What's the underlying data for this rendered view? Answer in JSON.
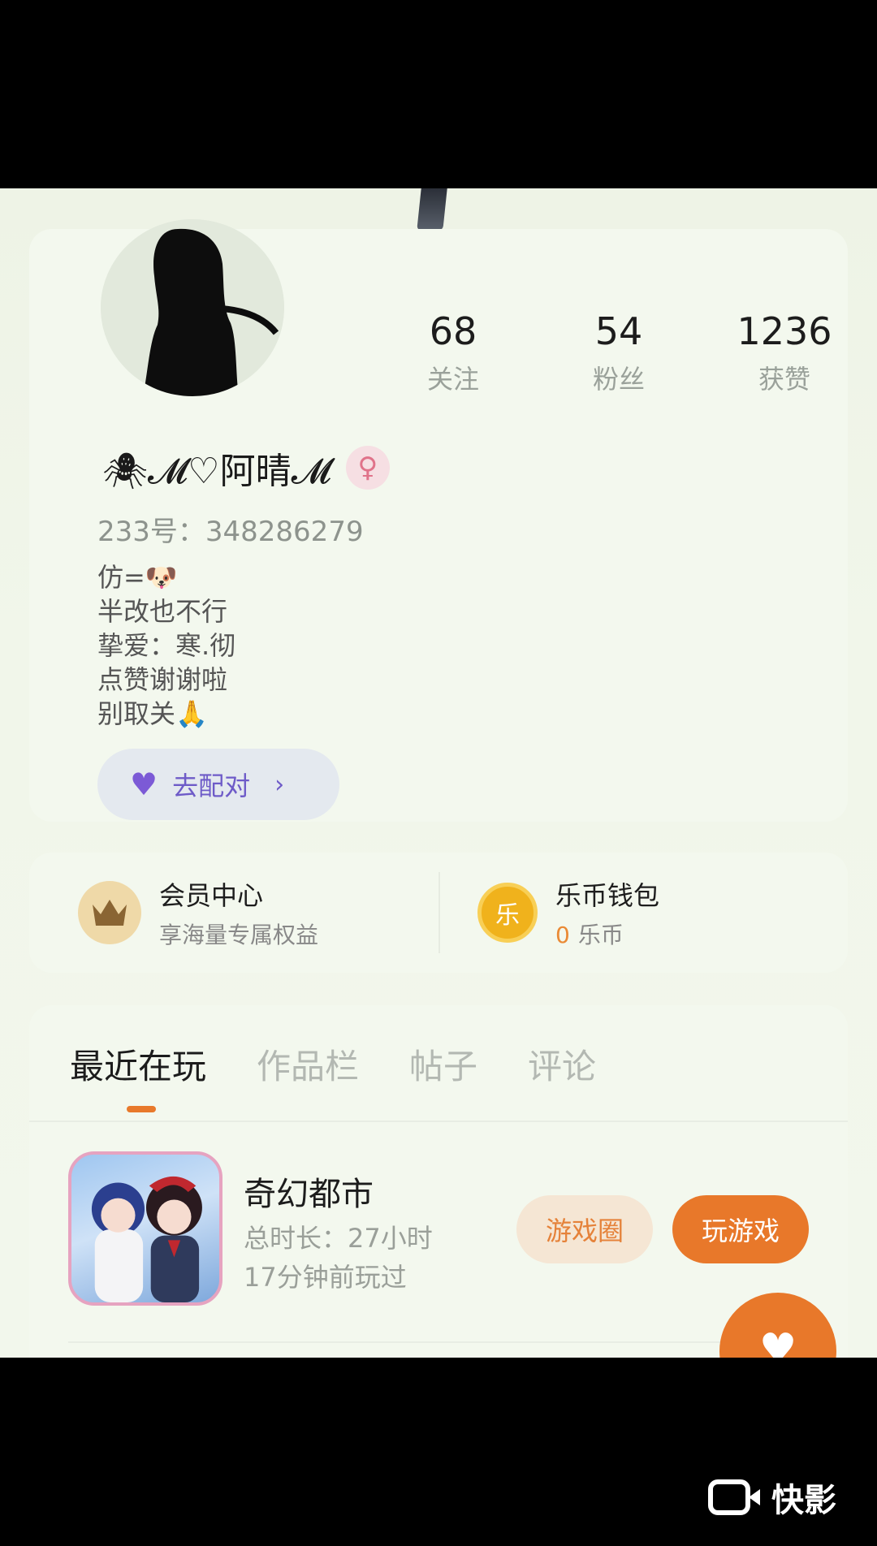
{
  "profile": {
    "stats": [
      {
        "value": "68",
        "label": "关注"
      },
      {
        "value": "54",
        "label": "粉丝"
      },
      {
        "value": "1236",
        "label": "获赞"
      }
    ],
    "name": "🕷𝓜♡阿晴𝓜",
    "gender_icon": "♀",
    "uid_text": "233号：348286279",
    "bio_lines": [
      "仿=🐶",
      "半改也不行",
      "挚爱：寒.彻",
      "点赞谢谢啦",
      "别取关🙏"
    ],
    "match_button": {
      "icon": "♥",
      "label": "去配对",
      "chevron": "›"
    }
  },
  "wallet": {
    "member": {
      "title": "会员中心",
      "subtitle": "享海量专属权益",
      "icon": "crown-icon"
    },
    "coins": {
      "title": "乐币钱包",
      "badge": "乐",
      "amount": "0",
      "unit": "乐币"
    }
  },
  "tabs": [
    "最近在玩",
    "作品栏",
    "帖子",
    "评论"
  ],
  "active_tab": 0,
  "recent_game": {
    "name": "奇幻都市",
    "duration": "总时长：27小时",
    "last_played": "17分钟前玩过",
    "circle_button": "游戏圈",
    "play_button": "玩游戏"
  },
  "fab_icon": "♥",
  "watermark": "快影",
  "colors": {
    "accent": "#e8782a",
    "match_purple": "#6e5bc8",
    "background": "#f2f7ec"
  }
}
